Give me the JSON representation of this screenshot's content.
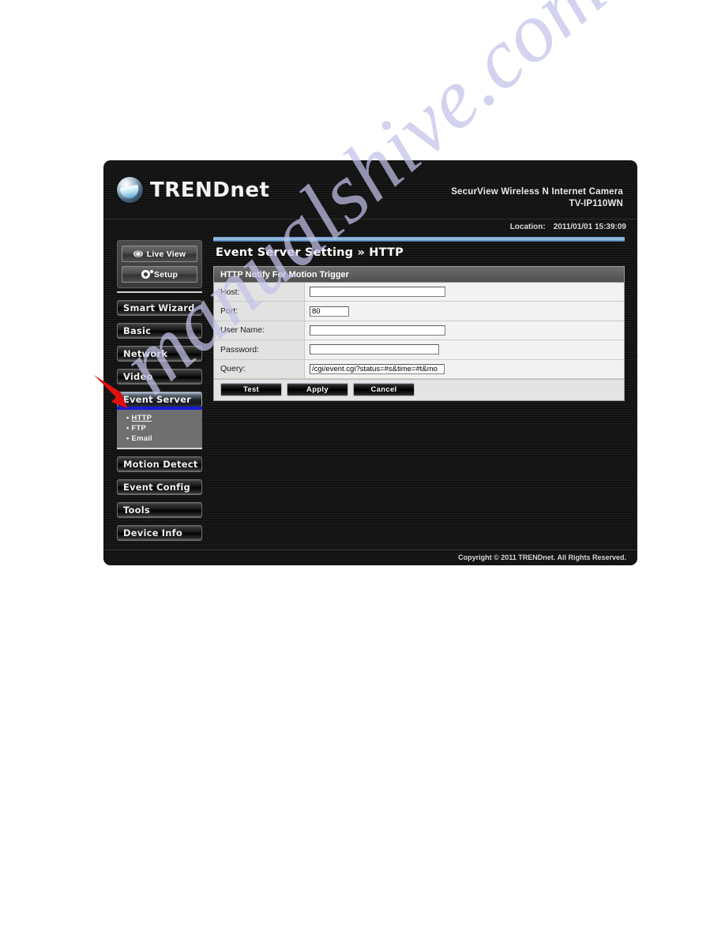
{
  "header": {
    "brand_main": "TREND",
    "brand_sub": "net",
    "product_line1": "SecurView Wireless N Internet Camera",
    "product_line2": "TV-IP110WN",
    "location_label": "Location:",
    "location_value": "2011/01/01 15:39:09"
  },
  "sidebar": {
    "view_buttons": [
      {
        "label": "Live View",
        "icon": "eye-icon"
      },
      {
        "label": "Setup",
        "icon": "gear-icon"
      }
    ],
    "items": [
      {
        "label": "Smart Wizard",
        "active": false
      },
      {
        "label": "Basic",
        "active": false
      },
      {
        "label": "Network",
        "active": false
      },
      {
        "label": "Video",
        "active": false
      },
      {
        "label": "Event Server",
        "active": true
      },
      {
        "label": "Motion Detect",
        "active": false
      },
      {
        "label": "Event Config",
        "active": false
      },
      {
        "label": "Tools",
        "active": false
      },
      {
        "label": "Device Info",
        "active": false
      }
    ],
    "submenu": [
      {
        "label": "HTTP",
        "active": true
      },
      {
        "label": "FTP",
        "active": false
      },
      {
        "label": "Email",
        "active": false
      }
    ],
    "bullet": "•"
  },
  "main": {
    "page_title": "Event Server Setting » HTTP",
    "section_title": "HTTP Notify For Motion Trigger",
    "fields": [
      {
        "label": "Host:",
        "value": ""
      },
      {
        "label": "Port:",
        "value": "80"
      },
      {
        "label": "User Name:",
        "value": ""
      },
      {
        "label": "Password:",
        "value": ""
      },
      {
        "label": "Query:",
        "value": "/cgi/event.cgi?status=#s&time=#t&mo"
      }
    ],
    "buttons": [
      {
        "label": "Test"
      },
      {
        "label": "Apply"
      },
      {
        "label": "Cancel"
      }
    ]
  },
  "footer": {
    "copyright": "Copyright © 2011 TRENDnet. All Rights Reserved."
  },
  "watermark": {
    "text": "manualshive.com"
  },
  "colors": {
    "accent_blue": "#1a1ad8",
    "annotation_red": "#e01010",
    "panel_black": "#161616",
    "watermark_lavender": "#c3c3ea"
  }
}
